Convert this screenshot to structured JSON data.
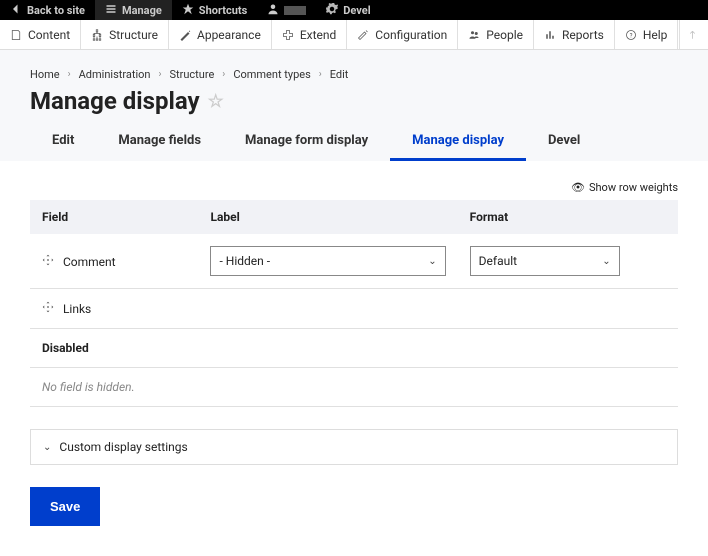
{
  "topbar": {
    "back": "Back to site",
    "manage": "Manage",
    "shortcuts": "Shortcuts",
    "user": "",
    "devel": "Devel"
  },
  "menubar": {
    "items": [
      {
        "label": "Content"
      },
      {
        "label": "Structure"
      },
      {
        "label": "Appearance"
      },
      {
        "label": "Extend"
      },
      {
        "label": "Configuration"
      },
      {
        "label": "People"
      },
      {
        "label": "Reports"
      },
      {
        "label": "Help"
      }
    ]
  },
  "breadcrumb": {
    "items": [
      "Home",
      "Administration",
      "Structure",
      "Comment types",
      "Edit"
    ]
  },
  "page_title": "Manage display",
  "tabs": {
    "items": [
      {
        "label": "Edit",
        "active": false
      },
      {
        "label": "Manage fields",
        "active": false
      },
      {
        "label": "Manage form display",
        "active": false
      },
      {
        "label": "Manage display",
        "active": true
      },
      {
        "label": "Devel",
        "active": false
      }
    ]
  },
  "show_weights": "Show row weights",
  "table": {
    "headers": {
      "field": "Field",
      "label": "Label",
      "format": "Format"
    },
    "rows": [
      {
        "name": "Comment",
        "label_value": "- Hidden -",
        "format_value": "Default",
        "has_selects": true
      },
      {
        "name": "Links",
        "has_selects": false
      }
    ],
    "disabled_header": "Disabled",
    "no_hidden": "No field is hidden."
  },
  "details_label": "Custom display settings",
  "save_label": "Save"
}
